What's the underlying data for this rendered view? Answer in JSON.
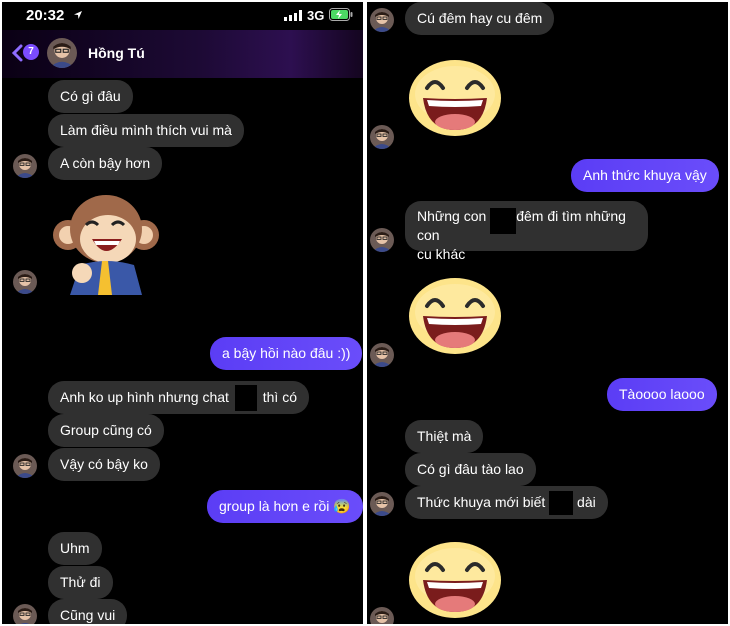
{
  "status": {
    "time": "20:32",
    "network": "3G"
  },
  "header": {
    "back_count": "7",
    "contact_name": "Hồng Tú"
  },
  "left_messages": {
    "m1": "Có gì đâu",
    "m2": "Làm điều mình thích vui mà",
    "m3": "A còn bậy hơn",
    "m4": "a bậy hồi nào đâu :))",
    "m5a": "Anh ko up hình nhưng chat",
    "m5b": "thì có",
    "m6": "Group cũng có",
    "m7": "Vậy có bậy ko",
    "m8": "group là hơn e rồi 😰",
    "m9": "Uhm",
    "m10": "Thử đi",
    "m11": "Cũng vui"
  },
  "right_messages": {
    "r1": "Cú đêm hay cu đêm",
    "r2": "Anh thức khuya vậy",
    "r3a": "Những con",
    "r3b": "đêm đi tìm những con",
    "r3c": "cu khác",
    "r4": "Tàoooo laooo",
    "r5": "Thiệt mà",
    "r6": "Có gì đâu tào lao",
    "r7a": "Thức khuya mới biết",
    "r7b": "dài"
  },
  "colors": {
    "incoming": "#303030",
    "outgoing": "#5b3df5",
    "background": "#000000"
  },
  "icons": [
    "location-arrow-icon",
    "signal-icon",
    "battery-charging-icon",
    "back-chevron-icon",
    "monkey-sticker",
    "smiley-sticker"
  ]
}
